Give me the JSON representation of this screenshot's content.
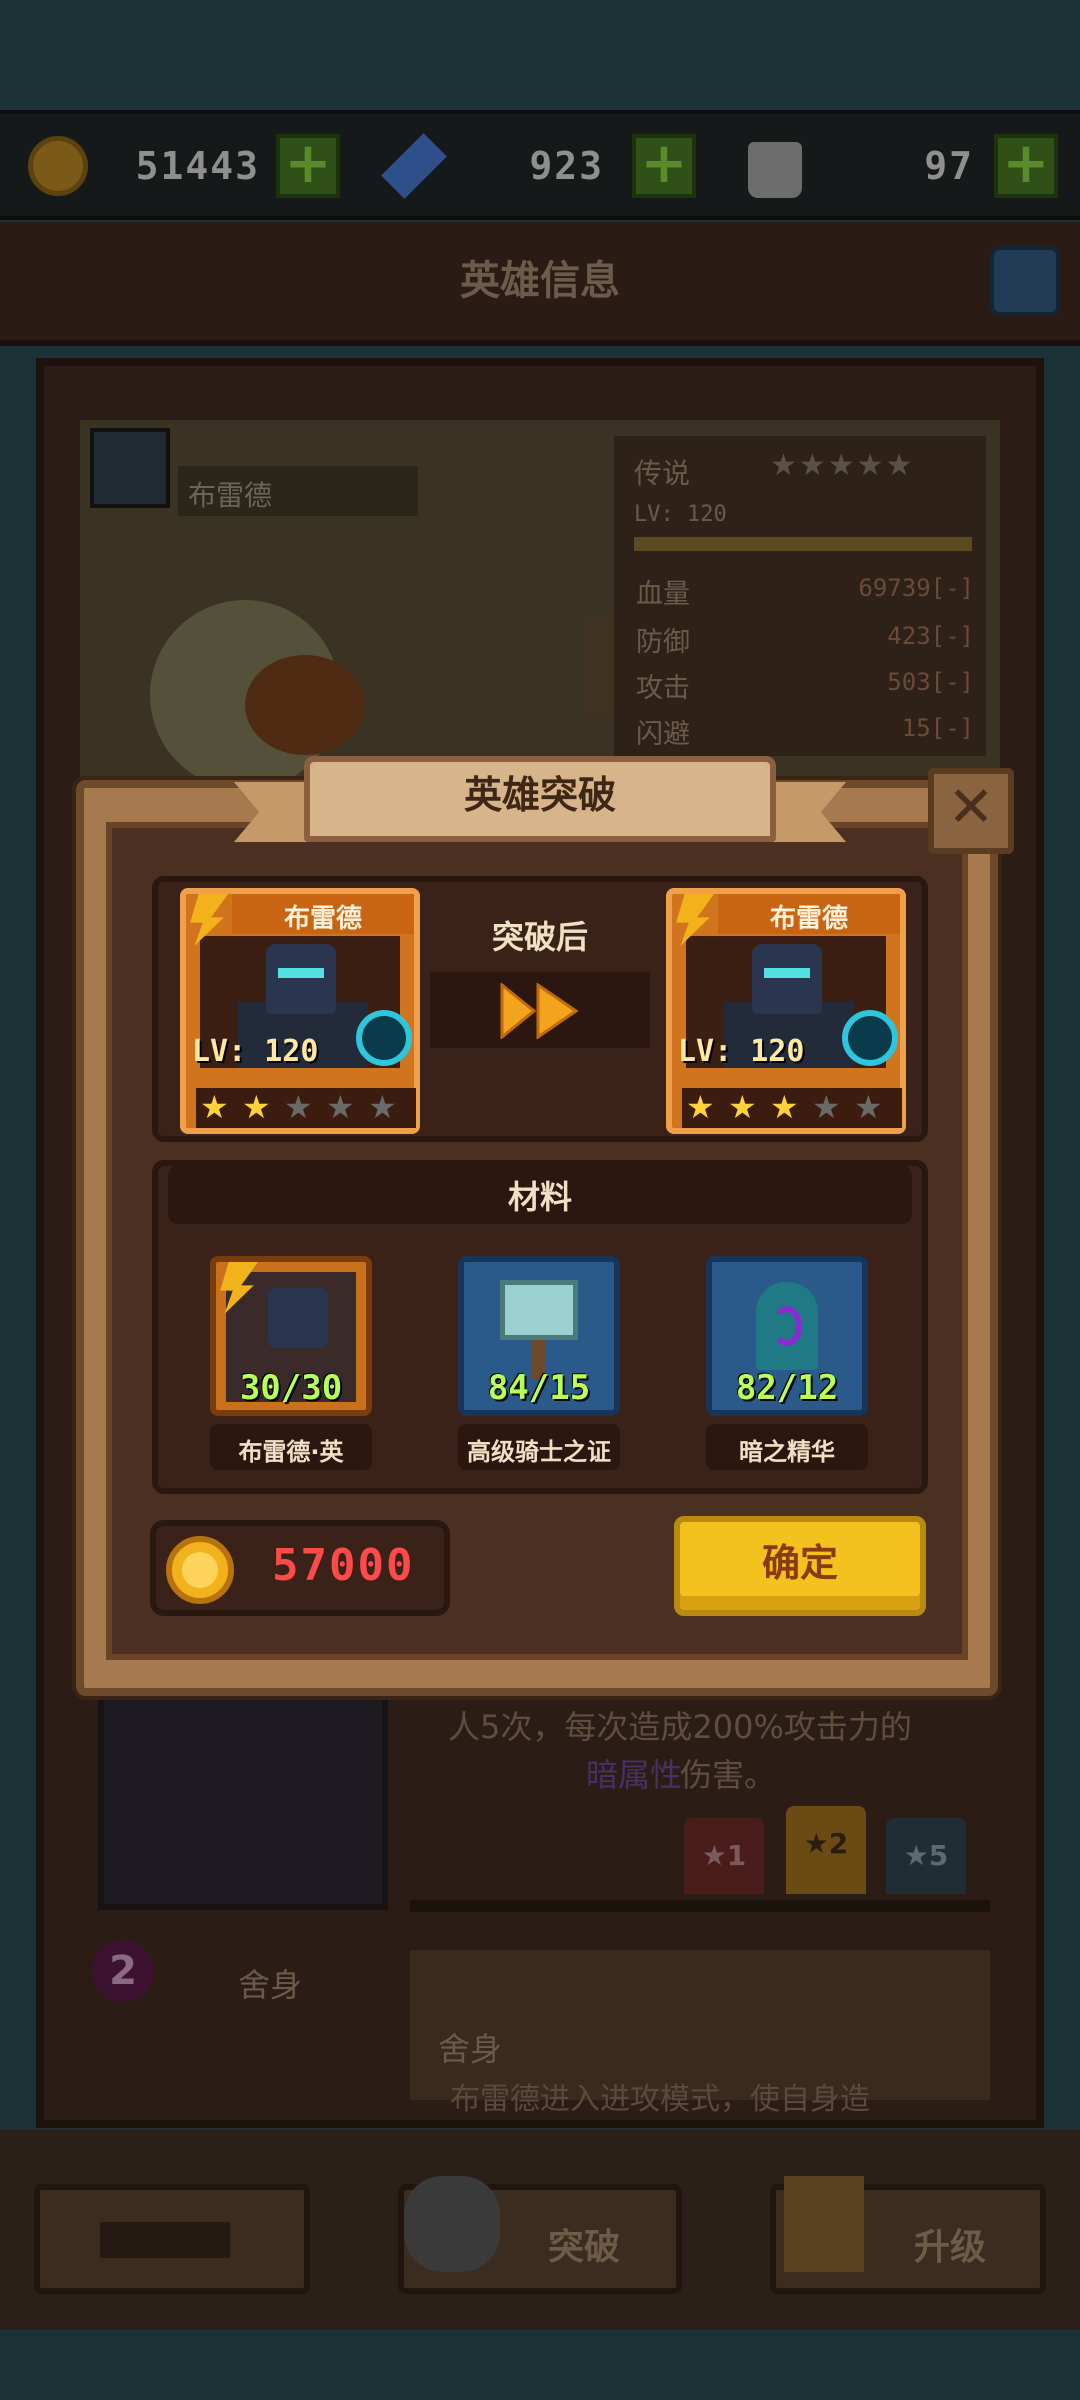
{
  "currency": {
    "gold": "51443",
    "gems": "923",
    "bag": "97"
  },
  "background": {
    "title": "英雄信息",
    "hero_name": "布雷德",
    "rarity": "传说",
    "level": "LV: 120",
    "stats": [
      {
        "label": "血量",
        "value": "69739[-]"
      },
      {
        "label": "防御",
        "value": "423[-]"
      },
      {
        "label": "攻击",
        "value": "503[-]"
      },
      {
        "label": "闪避",
        "value": "15[-]"
      }
    ],
    "skill_desc_line1": "人5次，每次造成200%攻击力的",
    "skill_desc_highlight": "暗属性",
    "skill_desc_tail": "伤害。",
    "star_badges": [
      "★1",
      "★2",
      "★5"
    ],
    "skill2_number": "2",
    "skill2_name": "舍身",
    "skill2_title": "舍身",
    "skill2_desc": "布雷德进入进攻模式，使自身造"
  },
  "bottom_nav": {
    "breakthrough": "突破",
    "upgrade": "升级"
  },
  "modal": {
    "title": "英雄突破",
    "after_label": "突破后",
    "before_card": {
      "name": "布雷德",
      "level": "LV: 120",
      "stars_filled": 2,
      "stars_total": 5
    },
    "after_card": {
      "name": "布雷德",
      "level": "LV: 120",
      "stars_filled": 3,
      "stars_total": 5
    },
    "materials_title": "材料",
    "materials": [
      {
        "name": "布雷德·英",
        "count": "30/30",
        "icon": "hero-shard-icon"
      },
      {
        "name": "高级骑士之证",
        "count": "84/15",
        "icon": "knight-badge-icon"
      },
      {
        "name": "暗之精华",
        "count": "82/12",
        "icon": "dark-essence-icon"
      }
    ],
    "cost": "57000",
    "confirm": "确定"
  },
  "colors": {
    "star_gold": "#ffd23a",
    "star_empty": "#6a6a6a",
    "count_green": "#b8ff5a",
    "cost_red": "#ff4a4a"
  }
}
